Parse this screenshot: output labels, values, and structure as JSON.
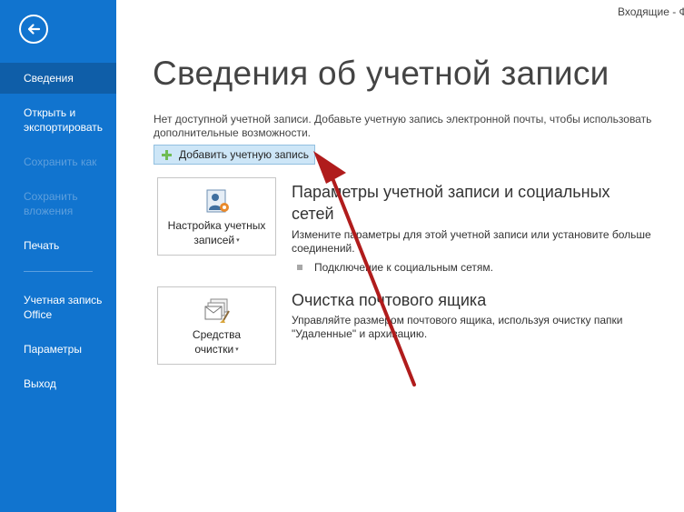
{
  "window": {
    "title": "Входящие - Ф"
  },
  "sidebar": {
    "back_icon": "back-arrow-icon",
    "items": [
      {
        "label": "Сведения",
        "active": true
      },
      {
        "label": "Открыть и экспортировать"
      },
      {
        "label": "Сохранить как",
        "disabled": true
      },
      {
        "label": "Сохранить вложения",
        "disabled": true
      },
      {
        "label": "Печать"
      },
      {
        "label": "Учетная запись Office"
      },
      {
        "label": "Параметры"
      },
      {
        "label": "Выход"
      }
    ]
  },
  "main": {
    "title": "Сведения об учетной записи",
    "info": "Нет доступной учетной записи. Добавьте учетную запись электронной почты, чтобы использовать дополнительные возможности.",
    "add_account_button": "Добавить учетную запись",
    "sections": [
      {
        "tile_label_line1": "Настройка учетных",
        "tile_label_line2": "записей",
        "title": "Параметры учетной записи и социальных сетей",
        "description": "Измените параметры для этой учетной записи или установите больше соединений.",
        "bullet": "Подключение к социальным сетям."
      },
      {
        "tile_label_line1": "Средства",
        "tile_label_line2": "очистки",
        "title": "Очистка почтового ящика",
        "description": "Управляйте размером почтового ящика, используя очистку папки \"Удаленные\" и архивацию."
      }
    ]
  },
  "colors": {
    "sidebar": "#1174cf",
    "sidebar_active": "#0f5ea8",
    "annotation_arrow": "#b01c1c"
  }
}
